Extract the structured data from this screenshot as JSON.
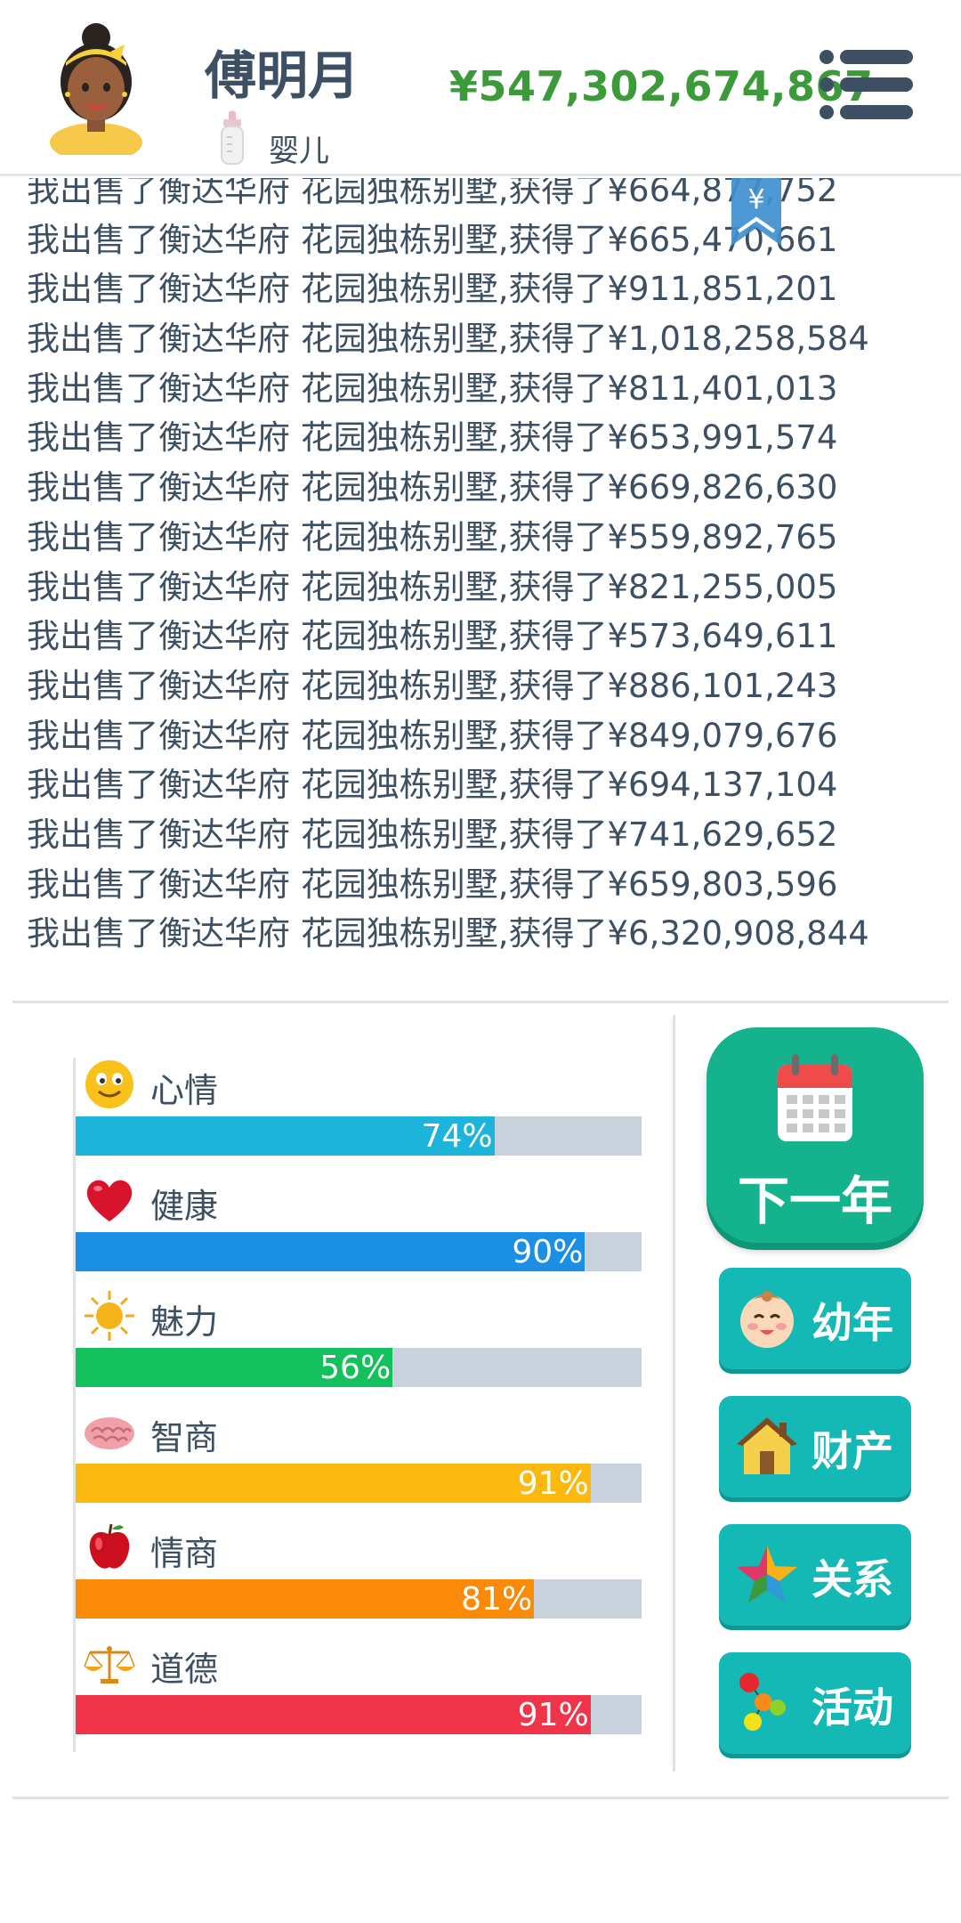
{
  "header": {
    "name": "傅明月",
    "age_stage": "婴儿",
    "money": "¥547,302,674,867"
  },
  "log": {
    "entries": [
      "我出售了衡达华府 花园独栋别墅,获得了¥664,877,752",
      "我出售了衡达华府 花园独栋别墅,获得了¥665,470,661",
      "我出售了衡达华府 花园独栋别墅,获得了¥911,851,201",
      "我出售了衡达华府 花园独栋别墅,获得了¥1,018,258,584",
      "我出售了衡达华府 花园独栋别墅,获得了¥811,401,013",
      "我出售了衡达华府 花园独栋别墅,获得了¥653,991,574",
      "我出售了衡达华府 花园独栋别墅,获得了¥669,826,630",
      "我出售了衡达华府 花园独栋别墅,获得了¥559,892,765",
      "我出售了衡达华府 花园独栋别墅,获得了¥821,255,005",
      "我出售了衡达华府 花园独栋别墅,获得了¥573,649,611",
      "我出售了衡达华府 花园独栋别墅,获得了¥886,101,243",
      "我出售了衡达华府 花园独栋别墅,获得了¥849,079,676",
      "我出售了衡达华府 花园独栋别墅,获得了¥694,137,104",
      "我出售了衡达华府 花园独栋别墅,获得了¥741,629,652",
      "我出售了衡达华府 花园独栋别墅,获得了¥659,803,596",
      "我出售了衡达华府 花园独栋别墅,获得了¥6,320,908,844"
    ],
    "bookmark_symbol": "¥"
  },
  "stats": [
    {
      "label": "心情",
      "value": 74,
      "pct_text": "74%",
      "color": "#1db4dc",
      "icon": "smiley-icon"
    },
    {
      "label": "健康",
      "value": 90,
      "pct_text": "90%",
      "color": "#1a8fe3",
      "icon": "heart-icon"
    },
    {
      "label": "魅力",
      "value": 56,
      "pct_text": "56%",
      "color": "#14c05c",
      "icon": "sun-icon"
    },
    {
      "label": "智商",
      "value": 91,
      "pct_text": "91%",
      "color": "#fbb80f",
      "icon": "brain-icon"
    },
    {
      "label": "情商",
      "value": 81,
      "pct_text": "81%",
      "color": "#fb8a08",
      "icon": "apple-icon"
    },
    {
      "label": "道德",
      "value": 91,
      "pct_text": "91%",
      "color": "#f0344a",
      "icon": "scales-icon"
    }
  ],
  "actions": {
    "next_year": "下一年",
    "childhood": "幼年",
    "assets": "财产",
    "relations": "关系",
    "activities": "活动"
  },
  "colors": {
    "money": "#3c9a3a",
    "primary_button": "#14b38d",
    "side_button": "#14b8b5",
    "text": "#3d4f62"
  }
}
